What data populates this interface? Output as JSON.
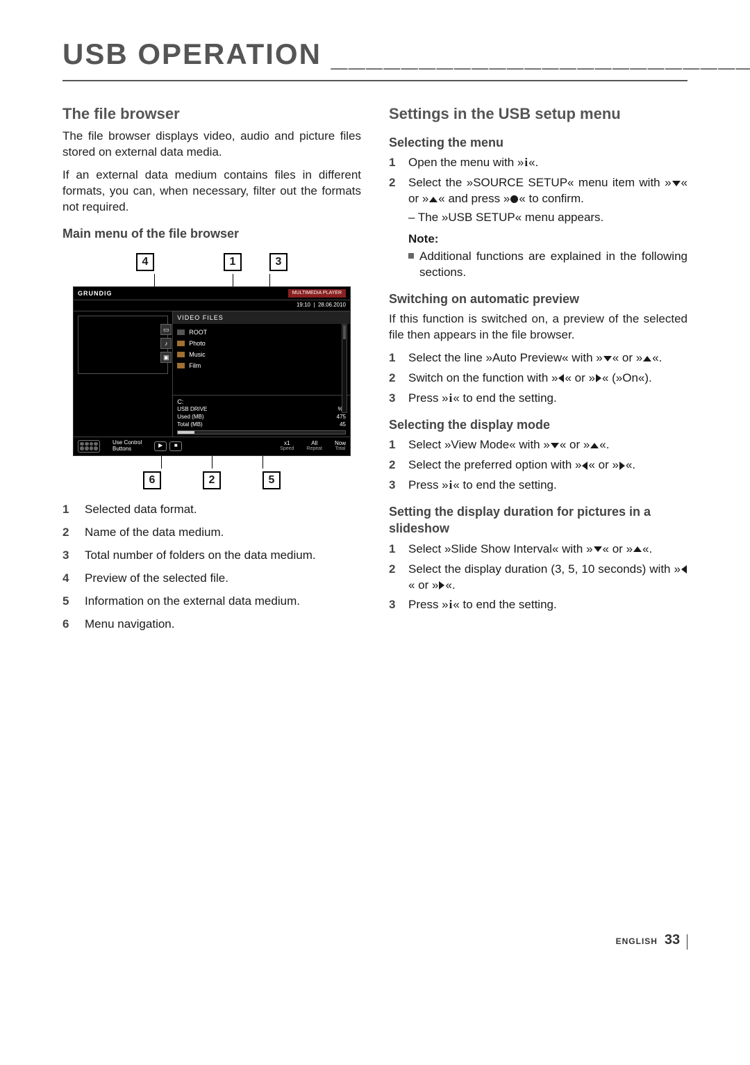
{
  "page": {
    "title": "USB OPERATION",
    "footer_lang": "ENGLISH",
    "footer_page": "33"
  },
  "left": {
    "heading1": "The file browser",
    "para1": "The file browser displays video, audio and picture files stored on external data media.",
    "para2": "If an external data medium contains files in different formats, you can, when necessary, filter out the formats not required.",
    "heading2": "Main menu of the file browser",
    "figure": {
      "callouts_top": [
        "4",
        "1",
        "3"
      ],
      "callouts_bottom": [
        "6",
        "2",
        "5"
      ],
      "brand": "GRUNDIG",
      "mm_label": "MULTIMEDIA PLAYER",
      "time": "19:10",
      "date": "28.06.2010",
      "files_header": "VIDEO FILES",
      "file_rows": [
        "ROOT",
        "Photo",
        "Music",
        "Film"
      ],
      "drive_letter": "C:",
      "drive_name": "USB DRIVE",
      "drive_pct": "%3",
      "used_label": "Used (MB)",
      "used_val": "475",
      "total_label": "Total (MB)",
      "total_val": "45",
      "use_control": "Use Control",
      "buttons_label": "Buttons",
      "footer_stats": [
        {
          "v": "x1",
          "l": "Speed"
        },
        {
          "v": "All",
          "l": "Repeat"
        },
        {
          "v": "Now",
          "l": "Total"
        }
      ]
    },
    "refs": [
      "Selected data format.",
      "Name of the data medium.",
      "Total number of folders on the data medium.",
      "Preview of the selected file.",
      "Information on the external data medium.",
      "Menu navigation."
    ]
  },
  "right": {
    "heading1": "Settings in the USB setup menu",
    "sub1": "Selecting the menu",
    "sel_menu_1a": "Open the menu with »",
    "sel_menu_1b": "«.",
    "sel_menu_2a": " Select the »SOURCE SETUP« menu item with »",
    "sel_menu_2b": "« or »",
    "sel_menu_2c": "« and press »",
    "sel_menu_2d": "« to confirm.",
    "sel_menu_dash": "– The »USB SETUP« menu appears.",
    "note_title": "Note:",
    "note_body": "Additional functions are explained in the following sections.",
    "sub2": "Switching on automatic preview",
    "sub2_para": "If this function is switched on, a preview of the selected file then appears in the file browser.",
    "auto_1a": "Select the line »Auto Preview« with »",
    "auto_1b": "« or »",
    "auto_1c": "«.",
    "auto_2a": "Switch on the function with »",
    "auto_2b": "« or »",
    "auto_2c": "« (»On«).",
    "auto_3a": "Press »",
    "auto_3b": "« to end the setting.",
    "sub3": "Selecting the display mode",
    "disp_1a": "Select »View Mode« with »",
    "disp_1b": "« or »",
    "disp_1c": "«.",
    "disp_2a": "Select the preferred option with »",
    "disp_2b": "« or »",
    "disp_2c": "«.",
    "disp_3a": "Press »",
    "disp_3b": "« to end the setting.",
    "sub4": "Setting the display duration for pictures in a slideshow",
    "slide_1a": "Select »Slide Show Interval« with »",
    "slide_1b": "« or »",
    "slide_1c": "«.",
    "slide_2a": "Select the display duration (3, 5, 10 seconds) with »",
    "slide_2b": "« or »",
    "slide_2c": "«.",
    "slide_3a": "Press »",
    "slide_3b": "« to end the setting."
  }
}
